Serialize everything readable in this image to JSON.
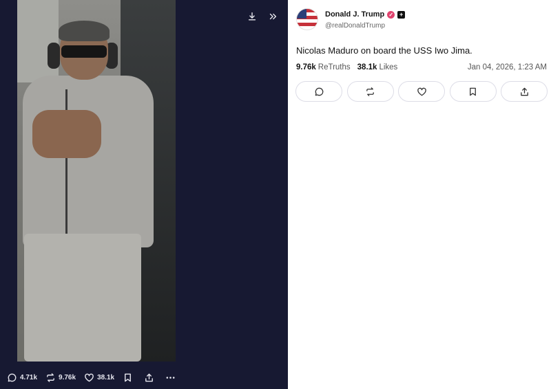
{
  "media": {
    "icons": {
      "download": "download-icon",
      "next": "chevrons-right-icon"
    },
    "stats": {
      "replies": "4.71k",
      "retruths": "9.76k",
      "likes": "38.1k"
    }
  },
  "post": {
    "author": {
      "name": "Donald J. Trump",
      "handle": "@realDonaldTrump",
      "verified_color": "#e0446f"
    },
    "text": "Nicolas Maduro on board the USS Iwo Jima.",
    "retruths_count": "9.76k",
    "retruths_label": "ReTruths",
    "likes_count": "38.1k",
    "likes_label": "Likes",
    "timestamp": "Jan 04, 2026, 1:23 AM",
    "action_icons": [
      "reply-icon",
      "retruth-icon",
      "like-icon",
      "bookmark-icon",
      "share-icon"
    ]
  },
  "colors": {
    "media_background": "#171932",
    "button_border": "#dcdce6"
  }
}
